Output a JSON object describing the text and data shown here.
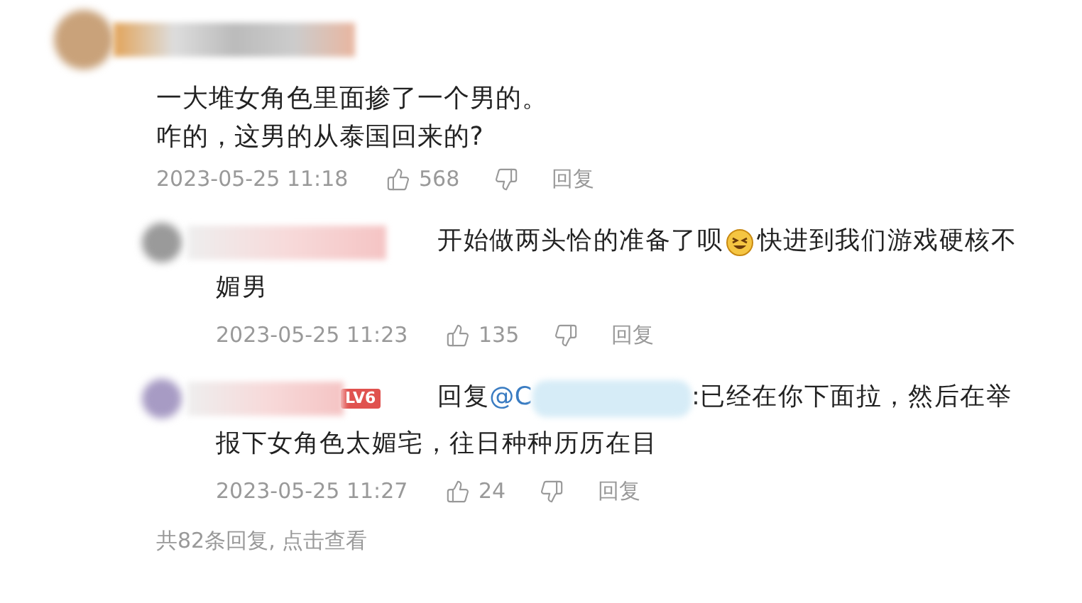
{
  "comment": {
    "lines": [
      "一大堆女角色里面掺了一个男的。",
      "咋的，这男的从泰国回来的?"
    ],
    "time": "2023-05-25 11:18",
    "likes": "568",
    "reply_label": "回复"
  },
  "replies": [
    {
      "segments": [
        {
          "kind": "text",
          "text": "开始做两头恰的准备了呗"
        },
        {
          "kind": "emoji"
        },
        {
          "kind": "text",
          "text": "快进到我们游戏硬核不"
        }
      ],
      "more_lines": [
        "媚男"
      ],
      "time": "2023-05-25 11:23",
      "likes": "135",
      "reply_label": "回复"
    },
    {
      "badge": "LV6",
      "segments": [
        {
          "kind": "text",
          "text": "回复 "
        },
        {
          "kind": "mention",
          "text": "@C"
        },
        {
          "kind": "blur"
        },
        {
          "kind": "text",
          "text": ":已经在你下面拉，然后在举"
        }
      ],
      "more_lines": [
        "报下女角色太媚宅，往日种种历历在目"
      ],
      "time": "2023-05-25 11:27",
      "likes": "24",
      "reply_label": "回复"
    }
  ],
  "footer": "共82条回复, 点击查看"
}
